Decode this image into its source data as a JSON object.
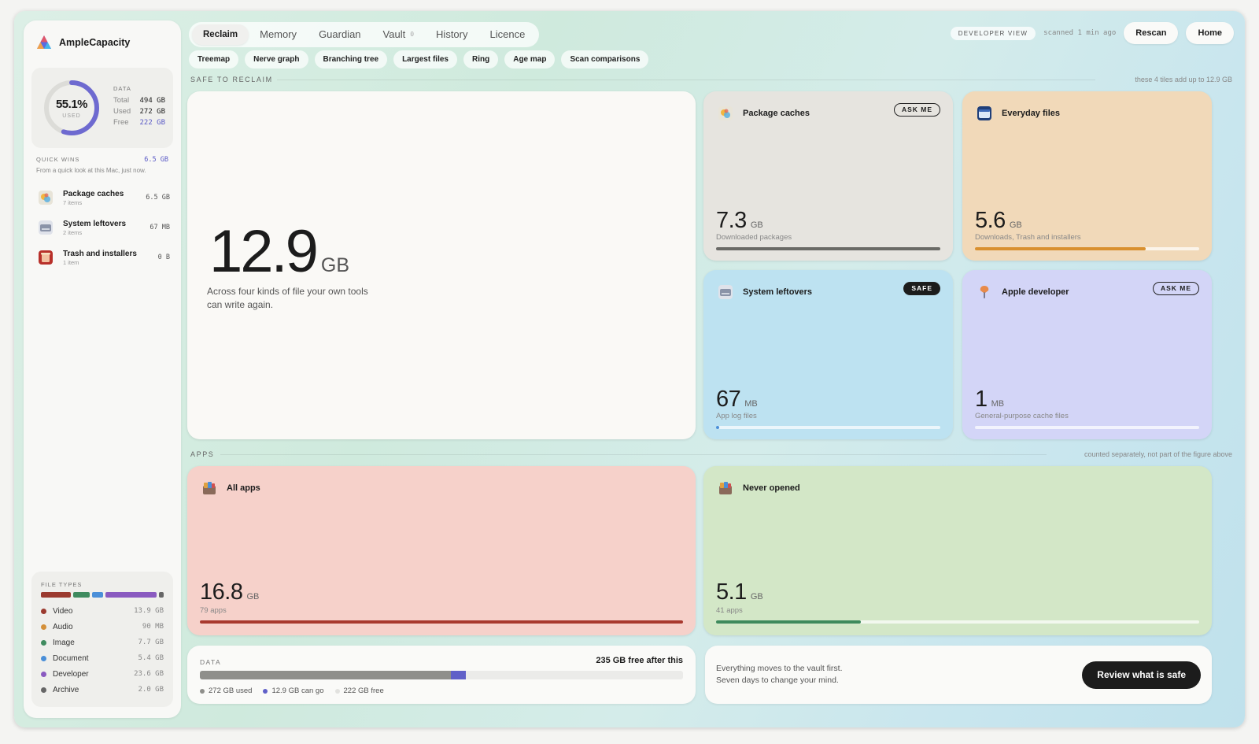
{
  "app": {
    "name": "AmpleCapacity"
  },
  "disk": {
    "used_pct": "55.1%",
    "used_fraction": 0.551,
    "used_label": "USED",
    "header": "DATA",
    "rows": [
      {
        "key": "Total",
        "value": "494 GB"
      },
      {
        "key": "Used",
        "value": "272 GB"
      },
      {
        "key": "Free",
        "value": "222 GB"
      }
    ]
  },
  "quick_wins": {
    "title": "QUICK WINS",
    "amount": "6.5 GB",
    "subtitle": "From a quick look at this Mac, just now.",
    "items": [
      {
        "title": "Package caches",
        "count": "7 items",
        "size": "6.5 GB"
      },
      {
        "title": "System leftovers",
        "count": "2 items",
        "size": "67 MB"
      },
      {
        "title": "Trash and installers",
        "count": "1 item",
        "size": "0 B"
      }
    ]
  },
  "file_types": {
    "title": "FILE TYPES",
    "items": [
      {
        "name": "Video",
        "size": "13.9 GB",
        "color": "#9b3a2f"
      },
      {
        "name": "Audio",
        "size": "90 MB",
        "color": "#d4903a"
      },
      {
        "name": "Image",
        "size": "7.7 GB",
        "color": "#3f8b5f"
      },
      {
        "name": "Document",
        "size": "5.4 GB",
        "color": "#4a8fd8"
      },
      {
        "name": "Developer",
        "size": "23.6 GB",
        "color": "#8a5ac0"
      },
      {
        "name": "Archive",
        "size": "2.0 GB",
        "color": "#666666"
      }
    ]
  },
  "nav": {
    "tabs": [
      {
        "label": "Reclaim",
        "active": true
      },
      {
        "label": "Memory"
      },
      {
        "label": "Guardian"
      },
      {
        "label": "Vault",
        "badge": "0"
      },
      {
        "label": "History"
      },
      {
        "label": "Licence"
      }
    ],
    "dev_view": "DEVELOPER VIEW",
    "scanned": "scanned 1 min ago",
    "rescan": "Rescan",
    "home": "Home"
  },
  "subnav": [
    "Treemap",
    "Nerve graph",
    "Branching tree",
    "Largest files",
    "Ring",
    "Age map",
    "Scan comparisons"
  ],
  "safe_section": {
    "label": "SAFE TO RECLAIM",
    "note": "these 4 tiles add up to 12.9 GB"
  },
  "hero": {
    "value": "12.9",
    "unit": "GB",
    "text": "Across four kinds of file your own tools can write again."
  },
  "tiles": {
    "package_caches": {
      "title": "Package caches",
      "badge": "ASK ME",
      "value": "7.3",
      "unit": "GB",
      "desc": "Downloaded packages",
      "fill": 1.0,
      "color": "#6a6a66"
    },
    "everyday_files": {
      "title": "Everyday files",
      "value": "5.6",
      "unit": "GB",
      "desc": "Downloads, Trash and installers",
      "fill": 0.76,
      "color": "#d9902f"
    },
    "system_leftovers": {
      "title": "System leftovers",
      "badge": "SAFE",
      "value": "67",
      "unit": "MB",
      "desc": "App log files",
      "fill": 0.01,
      "color": "#4a8fd8"
    },
    "apple_developer": {
      "title": "Apple developer",
      "badge": "ASK ME",
      "value": "1",
      "unit": "MB",
      "desc": "General-purpose cache files",
      "fill": 0.0,
      "color": "#8a7ad0"
    }
  },
  "apps_section": {
    "label": "APPS",
    "note": "counted separately, not part of the figure above"
  },
  "apps": {
    "all_apps": {
      "title": "All apps",
      "value": "16.8",
      "unit": "GB",
      "desc": "79 apps",
      "fill": 1.0,
      "color": "#a8392e"
    },
    "never_opened": {
      "title": "Never opened",
      "value": "5.1",
      "unit": "GB",
      "desc": "41 apps",
      "fill": 0.3,
      "color": "#3e8a5c"
    }
  },
  "data_bar": {
    "label": "DATA",
    "free_after": "235 GB free after this",
    "used_fraction": 0.52,
    "reclaim_fraction": 0.03,
    "legend": [
      {
        "label": "272 GB used",
        "color": "#8f8f8b"
      },
      {
        "label": "12.9 GB can go",
        "color": "#6060c8"
      },
      {
        "label": "222 GB free",
        "color": "#e2e2df"
      }
    ]
  },
  "vault_card": {
    "line1": "Everything moves to the vault first.",
    "line2": "Seven days to change your mind.",
    "button": "Review what is safe"
  }
}
